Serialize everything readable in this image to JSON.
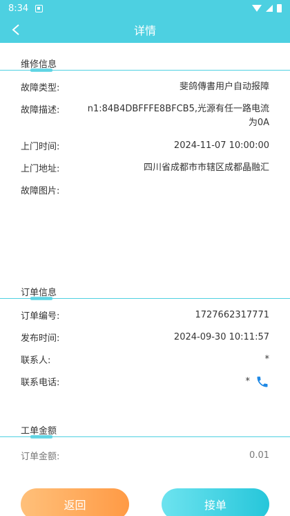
{
  "status_bar": {
    "time": "8:34"
  },
  "header": {
    "title": "详情"
  },
  "repair": {
    "section_title": "维修信息",
    "fault_type_label": "故障类型:",
    "fault_type_value": "斐鸽傳書用户自动报障",
    "fault_desc_label": "故障描述:",
    "fault_desc_value_line1": "n1:84B4DBFFFE8BFCB5,光源有任一路电流",
    "fault_desc_value_line2": "为0A",
    "visit_time_label": "上门时间:",
    "visit_time_value": "2024-11-07 10:00:00",
    "visit_addr_label": "上门地址:",
    "visit_addr_value": "四川省成都市市辖区成都晶融汇",
    "fault_images_label": "故障图片:"
  },
  "order": {
    "section_title": "订单信息",
    "order_no_label": "订单编号:",
    "order_no_value": "1727662317771",
    "publish_time_label": "发布时间:",
    "publish_time_value": "2024-09-30 10:11:57",
    "contact_label": "联系人:",
    "contact_value": "*",
    "phone_label": "联系电话:",
    "phone_value": "*"
  },
  "amount": {
    "section_title": "工单金额",
    "order_amount_label": "订单金额:",
    "order_amount_value": "0.01"
  },
  "actions": {
    "back_label": "返回",
    "accept_label": "接单"
  },
  "colors": {
    "accent": "#4dd0e1",
    "back_button": "#ffa552",
    "phone_icon": "#1e88e5"
  }
}
